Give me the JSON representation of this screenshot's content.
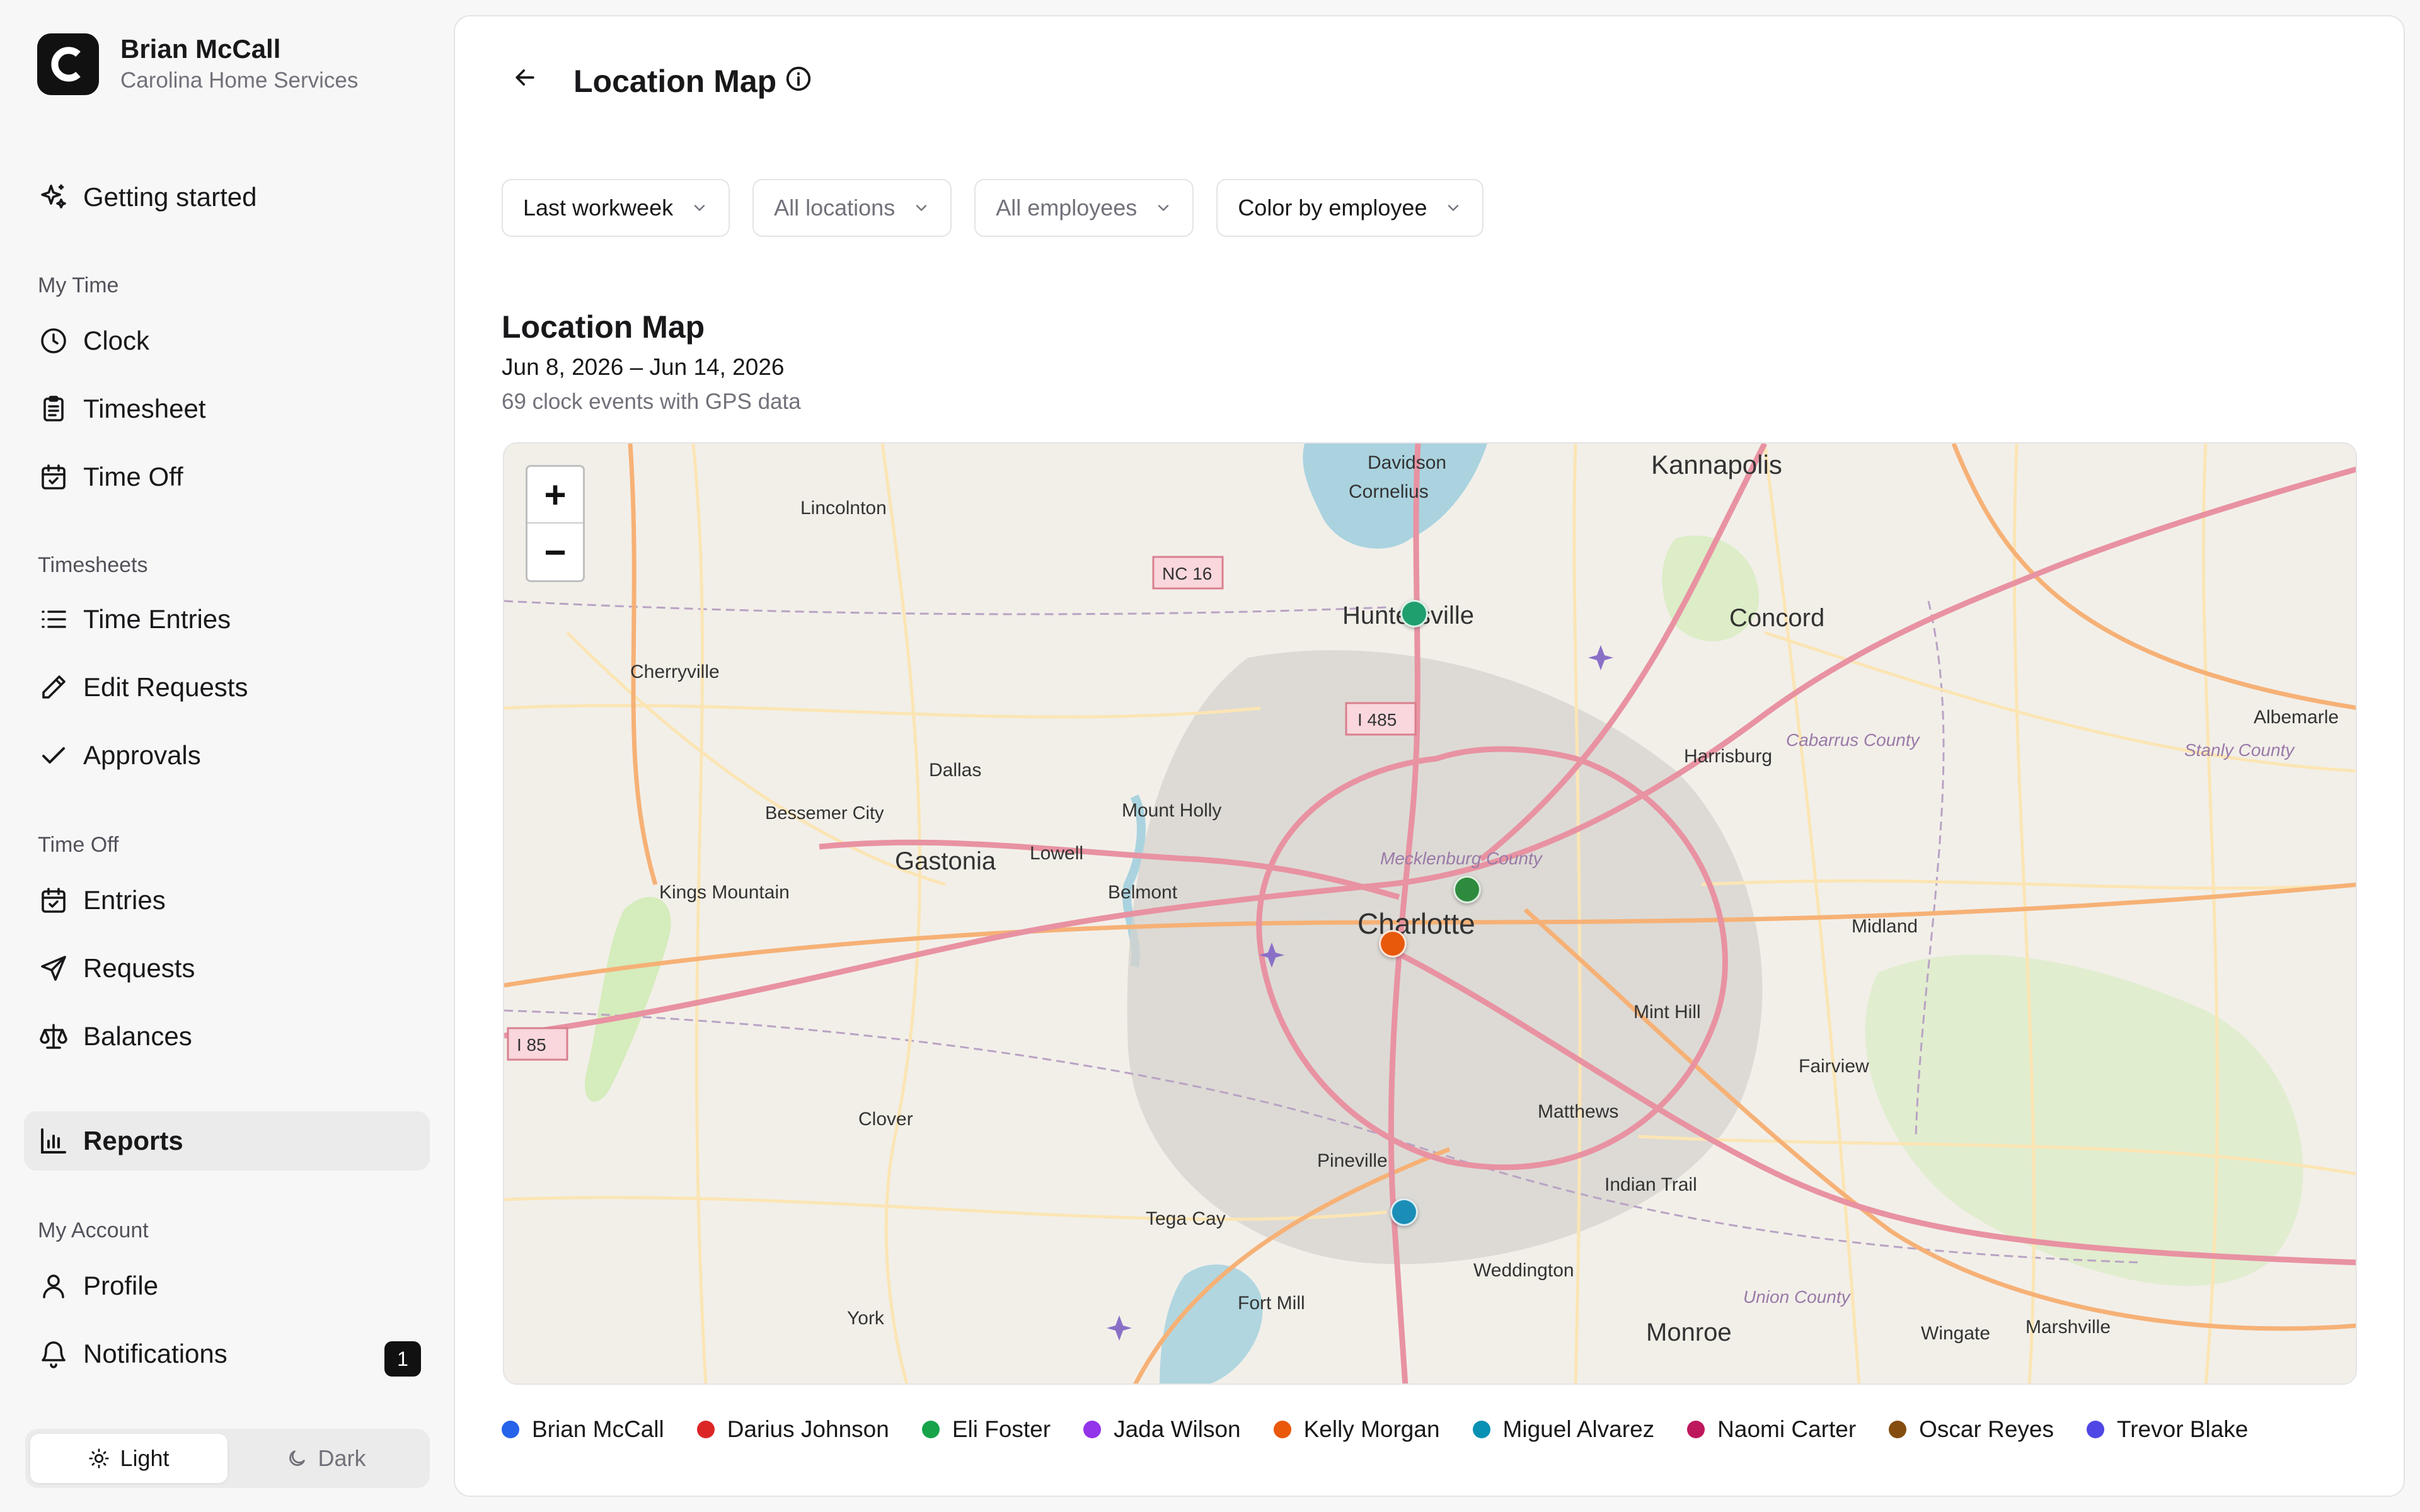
{
  "user": {
    "name": "Brian McCall",
    "company": "Carolina Home Services"
  },
  "nav": {
    "getting_started": "Getting started",
    "my_time": {
      "heading": "My Time",
      "clock": "Clock",
      "timesheet": "Timesheet",
      "time_off": "Time Off"
    },
    "timesheets": {
      "heading": "Timesheets",
      "time_entries": "Time Entries",
      "edit_requests": "Edit Requests",
      "approvals": "Approvals"
    },
    "time_off": {
      "heading": "Time Off",
      "entries": "Entries",
      "requests": "Requests",
      "balances": "Balances"
    },
    "reports": "Reports",
    "my_account": {
      "heading": "My Account",
      "profile": "Profile",
      "notifications": "Notifications",
      "notifications_count": "1"
    }
  },
  "theme": {
    "light": "Light",
    "dark": "Dark",
    "selected": "Light"
  },
  "page": {
    "title": "Location Map"
  },
  "filters": {
    "period": "Last workweek",
    "locations": "All locations",
    "employees": "All employees",
    "color_by": "Color by employee"
  },
  "report": {
    "title": "Location Map",
    "date_range": "Jun 8, 2026 – Jun 14, 2026",
    "summary": "69 clock events with GPS data"
  },
  "map": {
    "zoom_in": "+",
    "zoom_out": "−",
    "labels": {
      "davidson": "Davidson",
      "cornelius": "Cornelius",
      "kannapolis": "Kannapolis",
      "lincolnton": "Lincolnton",
      "nc16": "NC 16",
      "huntersville": "Huntersville",
      "concord": "Concord",
      "cherryville": "Cherryville",
      "i485": "I 485",
      "cabarrus": "Cabarrus County",
      "albemarle": "Albemarle",
      "stanly": "Stanly County",
      "harrisburg": "Harrisburg",
      "dallas": "Dallas",
      "mount_holly": "Mount Holly",
      "bessemer": "Bessemer City",
      "gastonia": "Gastonia",
      "lowell": "Lowell",
      "mecklenburg": "Mecklenburg County",
      "kings_mountain": "Kings Mountain",
      "belmont": "Belmont",
      "charlotte": "Charlotte",
      "midland": "Midland",
      "i85": "I 85",
      "mint_hill": "Mint Hill",
      "fairview": "Fairview",
      "clover": "Clover",
      "matthews": "Matthews",
      "pineville": "Pineville",
      "indian_trail": "Indian Trail",
      "tega_cay": "Tega Cay",
      "weddington": "Weddington",
      "union": "Union County",
      "fort_mill": "Fort Mill",
      "york": "York",
      "monroe": "Monroe",
      "wingate": "Wingate",
      "marshville": "Marshville"
    },
    "pins": [
      {
        "employee": "Eli Foster",
        "color": "#1f9e6e"
      },
      {
        "employee": "Eli Foster",
        "color": "#2e8b3e"
      },
      {
        "employee": "Kelly Morgan",
        "color": "#e8590c"
      },
      {
        "employee": "Miguel Alvarez",
        "color": "#1b8eb8"
      }
    ]
  },
  "legend": [
    {
      "name": "Brian McCall",
      "color": "#2563eb"
    },
    {
      "name": "Darius Johnson",
      "color": "#dc2626"
    },
    {
      "name": "Eli Foster",
      "color": "#16a34a"
    },
    {
      "name": "Jada Wilson",
      "color": "#9333ea"
    },
    {
      "name": "Kelly Morgan",
      "color": "#ea580c"
    },
    {
      "name": "Miguel Alvarez",
      "color": "#0891b2"
    },
    {
      "name": "Naomi Carter",
      "color": "#be185d"
    },
    {
      "name": "Oscar Reyes",
      "color": "#854d0e"
    },
    {
      "name": "Trevor Blake",
      "color": "#4f46e5"
    }
  ]
}
